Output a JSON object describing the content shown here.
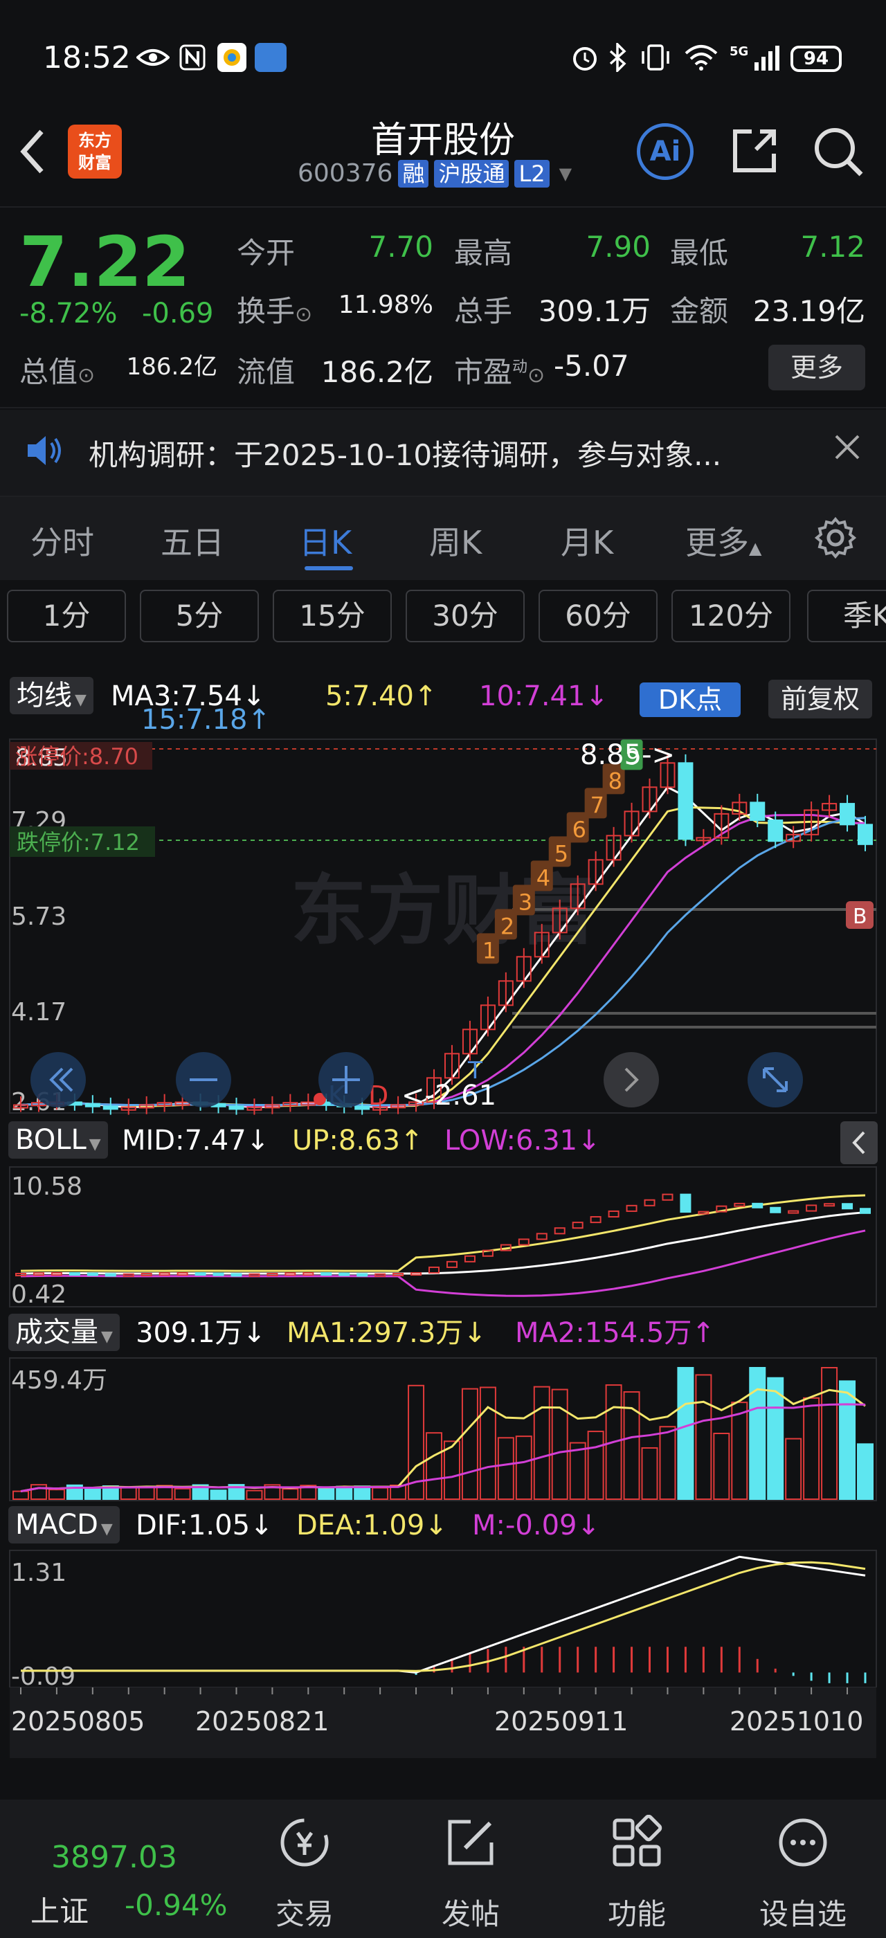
{
  "status": {
    "time": "18:52",
    "network": "5G",
    "battery": "94"
  },
  "header": {
    "title": "首开股份",
    "code": "600376",
    "tags": [
      "融",
      "沪股通",
      "L2"
    ],
    "logo_line1": "东方",
    "logo_line2": "财富",
    "ai_label": "Ai"
  },
  "quote": {
    "price": "7.22",
    "change_pct": "-8.72%",
    "change": "-0.69",
    "rows": [
      [
        {
          "label": "今开",
          "value": "7.70",
          "color": "green"
        },
        {
          "label": "最高",
          "value": "7.90",
          "color": "green"
        },
        {
          "label": "最低",
          "value": "7.12",
          "color": "green"
        }
      ],
      [
        {
          "label": "换手",
          "value": "11.98%",
          "color": "white"
        },
        {
          "label": "总手",
          "value": "309.1万",
          "color": "white"
        },
        {
          "label": "金额",
          "value": "23.19亿",
          "color": "white"
        }
      ],
      [
        {
          "label": "总值",
          "value": "186.2亿",
          "color": "white"
        },
        {
          "label": "流值",
          "value": "186.2亿",
          "color": "white"
        },
        {
          "label": "市盈",
          "value": "-5.07",
          "color": "white"
        }
      ]
    ],
    "pe_sup": "动",
    "more": "更多"
  },
  "notice": {
    "text": "机构调研：于2025-10-10接待调研，参与对象..."
  },
  "tabs": [
    "分时",
    "五日",
    "日K",
    "周K",
    "月K",
    "更多"
  ],
  "active_tab": "日K",
  "periods": [
    "1分",
    "5分",
    "15分",
    "30分",
    "60分",
    "120分",
    "季K"
  ],
  "ma_row": {
    "selector": "均线",
    "ma3": "MA3:7.54↓",
    "ma5": "5:7.40↑",
    "ma10": "10:7.41↓",
    "ma15": "15:7.18↑",
    "dk": "DK点",
    "fq": "前复权"
  },
  "kchart": {
    "y_labels": [
      "8.85",
      "7.29",
      "5.73",
      "4.17",
      "2.61"
    ],
    "limit_up": "涨停价:8.70",
    "limit_down": "跌停价:7.12",
    "high_mark": "8.85->",
    "low_mark": "<-2.61",
    "watermark": "东方财富",
    "seq_labels": [
      "1",
      "2",
      "3",
      "4",
      "5",
      "6",
      "7",
      "8",
      "9"
    ],
    "b_mark": "B",
    "k_mark": "K",
    "d_mark": "D",
    "t_mark": "T"
  },
  "boll": {
    "selector": "BOLL",
    "mid": "MID:7.47↓",
    "up": "UP:8.63↑",
    "low": "LOW:6.31↓",
    "y_top": "10.58",
    "y_bottom": "0.42"
  },
  "volume": {
    "selector": "成交量",
    "value": "309.1万↓",
    "ma1": "MA1:297.3万↓",
    "ma2": "MA2:154.5万↑",
    "y_top": "459.4万"
  },
  "macd": {
    "selector": "MACD",
    "dif": "DIF:1.05↓",
    "dea": "DEA:1.09↓",
    "m": "M:-0.09↓",
    "y_top": "1.31",
    "y_bottom": "-0.09"
  },
  "dates": [
    "20250805",
    "20250821",
    "20250911",
    "20251010"
  ],
  "bottom": {
    "index_value": "3897.03",
    "index_name": "上证",
    "index_change": "-0.94%",
    "nav": [
      "交易",
      "发帖",
      "功能",
      "设自选"
    ]
  },
  "colors": {
    "up": "#e03a3a",
    "down": "#5ee6f0",
    "ma3": "#ffffff",
    "ma5": "#f3e66b",
    "ma10": "#d23fd6",
    "ma15": "#5aa6e8",
    "accent": "#3d7bd8",
    "green": "#3fc04a"
  }
}
